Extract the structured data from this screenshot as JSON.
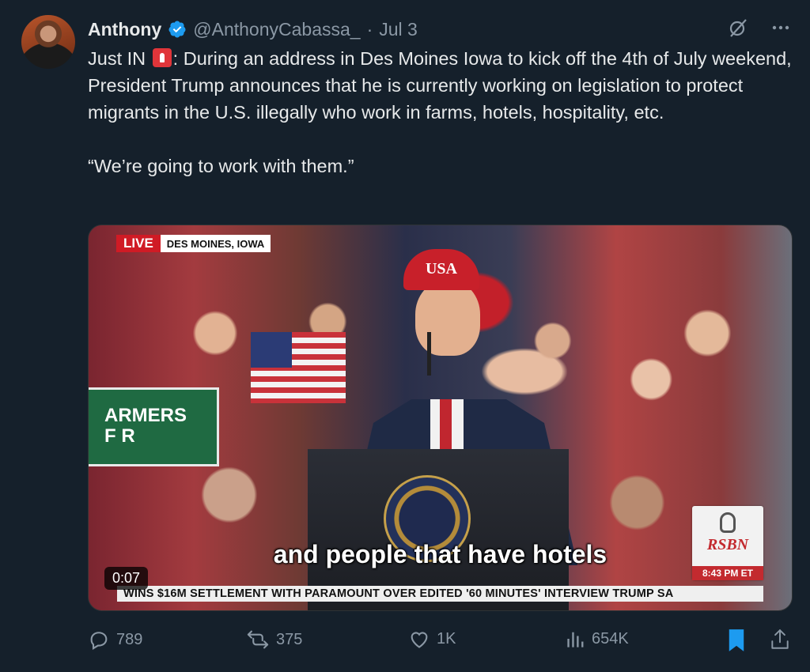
{
  "tweet": {
    "author_name": "Anthony",
    "handle": "@AnthonyCabassa_",
    "dot": "·",
    "date": "Jul 3",
    "text_intro": "Just IN ",
    "text_body": ": During an address in Des Moines Iowa to kick off the 4th of July weekend, President Trump announces that he is currently working on legislation to protect migrants in the U.S. illegally who work in farms, hotels, hospitality, etc.",
    "quote": "“We’re going to work with them.”"
  },
  "video": {
    "live_label": "LIVE",
    "location": "DES MOINES, IOWA",
    "caption": "and people that have hotels",
    "duration": "0:07",
    "ticker": "WINS $16M SETTLEMENT WITH PARAMOUNT OVER EDITED '60 MINUTES' INTERVIEW      TRUMP SA",
    "network": "RSBN",
    "time": "8:43 PM ET",
    "cap_text": "USA",
    "sign_text": "ARMERS\nF R"
  },
  "actions": {
    "replies": "789",
    "reposts": "375",
    "likes": "1K",
    "views": "654K"
  },
  "colors": {
    "background": "#15202b",
    "verified": "#1d9bf0",
    "bookmark_active": "#1d9bf0",
    "muted": "#8b98a5"
  }
}
